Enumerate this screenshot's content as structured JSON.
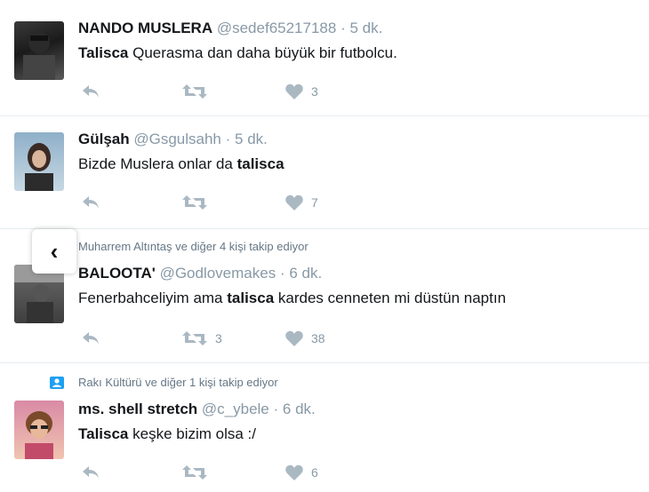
{
  "tweets": [
    {
      "name": "NANDO MUSLERA",
      "handle": "@sedef65217188",
      "time": "5 dk.",
      "text_parts": [
        {
          "text": "Talisca",
          "bold": true
        },
        {
          "text": " Querasma dan daha büyük bir futbolcu.",
          "bold": false
        }
      ],
      "retweets": "",
      "likes": "3"
    },
    {
      "name": "Gülşah",
      "handle": "@Gsgulsahh",
      "time": "5 dk.",
      "text_parts": [
        {
          "text": "Bizde Muslera onlar da ",
          "bold": false
        },
        {
          "text": "talisca",
          "bold": true
        }
      ],
      "retweets": "",
      "likes": "7"
    },
    {
      "context": "Muharrem Altıntaş ve diğer 4 kişi takip ediyor",
      "name": "BALOOTA'",
      "handle": "@Godlovemakes",
      "time": "6 dk.",
      "text_parts": [
        {
          "text": "Fenerbahceliyim ama ",
          "bold": false
        },
        {
          "text": "talisca",
          "bold": true
        },
        {
          "text": " kardes cenneten mi düstün naptın",
          "bold": false
        }
      ],
      "retweets": "3",
      "likes": "38"
    },
    {
      "context": "Rakı Kültürü ve diğer 1 kişi takip ediyor",
      "name": "ms. shell stretch",
      "handle": "@c_ybele",
      "time": "6 dk.",
      "text_parts": [
        {
          "text": "Talisca",
          "bold": true
        },
        {
          "text": " keşke bizim olsa :/",
          "bold": false
        }
      ],
      "retweets": "",
      "likes": "6"
    }
  ],
  "nav": {
    "back_glyph": "‹"
  },
  "colors": {
    "muted": "#8899a6",
    "accent": "#1da1f2",
    "separator": "#e6ecf0"
  },
  "icons": [
    "reply-icon",
    "retweet-icon",
    "like-icon",
    "follow-context-icon",
    "chevron-left-icon"
  ]
}
